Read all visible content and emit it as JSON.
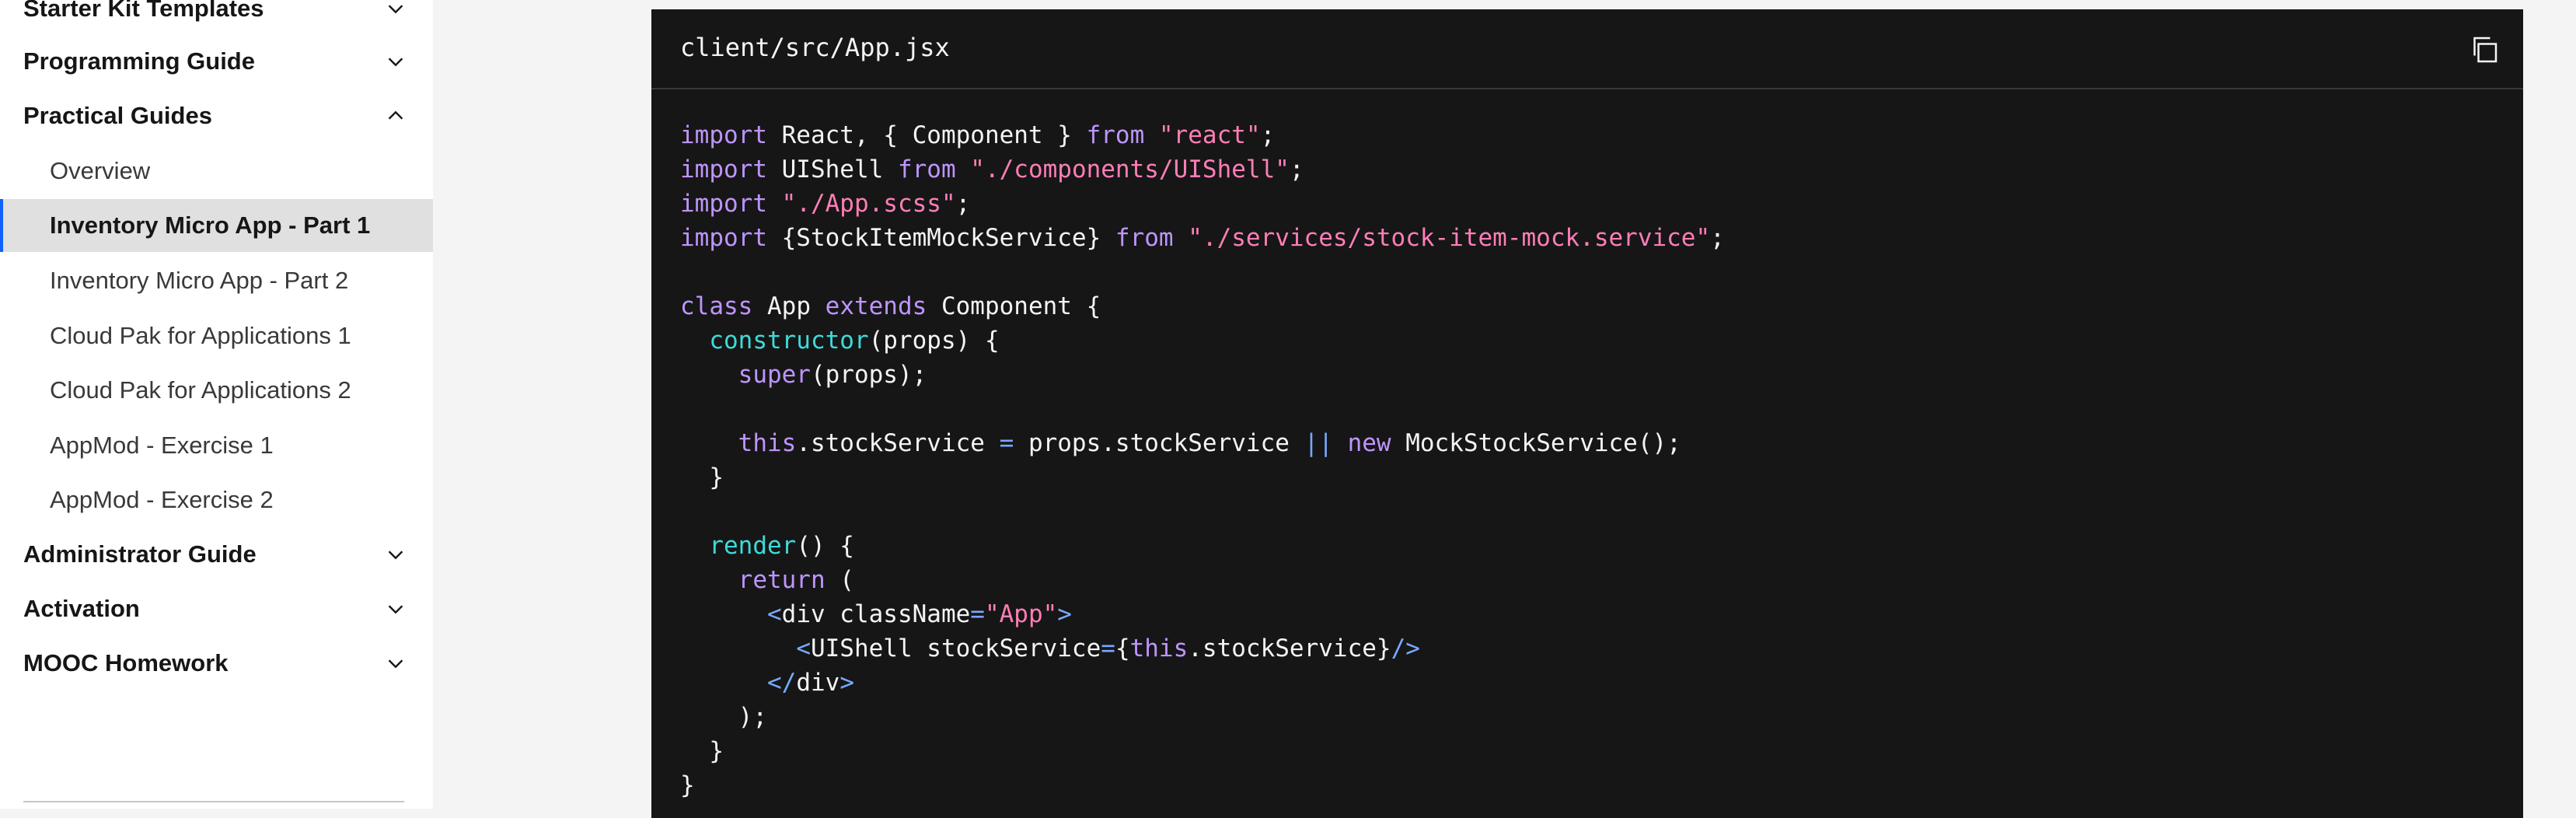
{
  "sidebar": {
    "categories": [
      {
        "label": "Starter Kit Templates",
        "icon": "chevron-down-icon"
      },
      {
        "label": "Programming Guide",
        "icon": "chevron-down-icon"
      },
      {
        "label": "Practical Guides",
        "icon": "chevron-up-icon"
      },
      {
        "label": "Administrator Guide",
        "icon": "chevron-down-icon"
      },
      {
        "label": "Activation",
        "icon": "chevron-down-icon"
      },
      {
        "label": "MOOC Homework",
        "icon": "chevron-down-icon"
      }
    ],
    "items": [
      {
        "label": "Overview"
      },
      {
        "label": "Inventory Micro App - Part 1"
      },
      {
        "label": "Inventory Micro App - Part 2"
      },
      {
        "label": "Cloud Pak for Applications 1"
      },
      {
        "label": "Cloud Pak for Applications 2"
      },
      {
        "label": "AppMod - Exercise 1"
      },
      {
        "label": "AppMod - Exercise 2"
      }
    ]
  },
  "code": {
    "filename": "client/src/App.jsx",
    "copy_icon": "copy-icon",
    "lines": [
      "import React, { Component } from \"react\";",
      "import UIShell from \"./components/UIShell\";",
      "import \"./App.scss\";",
      "import {StockItemMockService} from \"./services/stock-item-mock.service\";",
      "",
      "class App extends Component {",
      "  constructor(props) {",
      "    super(props);",
      "",
      "    this.stockService = props.stockService || new MockStockService();",
      "  }",
      "",
      "  render() {",
      "    return (",
      "      <div className=\"App\">",
      "        <UIShell stockService={this.stockService}/>",
      "      </div>",
      "    );",
      "  }",
      "}"
    ]
  },
  "colors": {
    "keyword": "#be95ff",
    "string": "#ff7eb6",
    "function": "#3ddbd9",
    "operator": "#78a9ff",
    "active_border": "#0f62fe"
  }
}
